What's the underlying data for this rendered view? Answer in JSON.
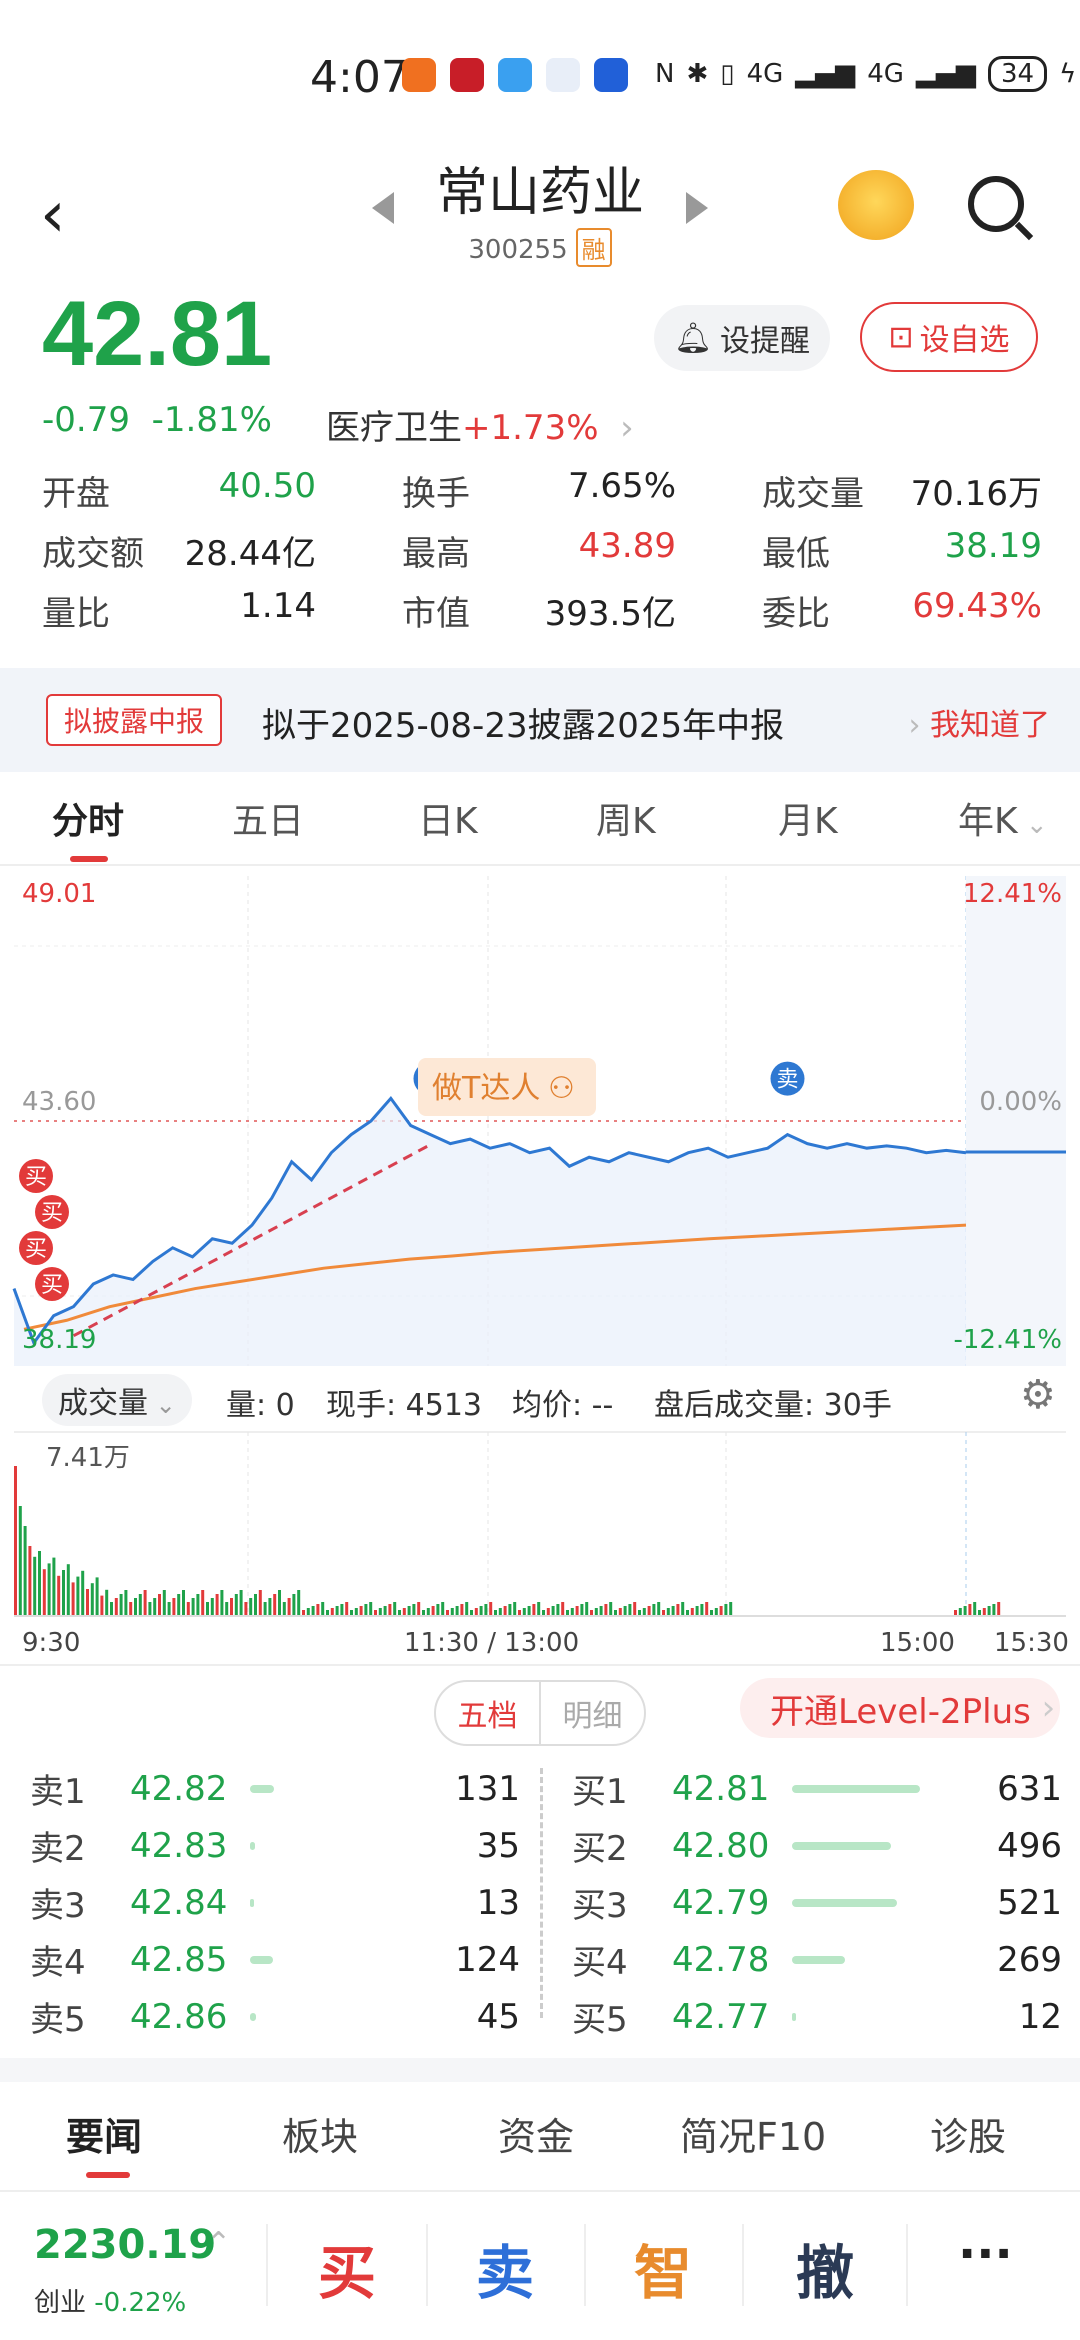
{
  "status_bar": {
    "time": "4:07",
    "net1": "4G",
    "net2": "4G",
    "battery": "34"
  },
  "header": {
    "title": "常山药业",
    "code": "300255",
    "margin_badge": "融"
  },
  "quote": {
    "price": "42.81",
    "change": "-0.79",
    "change_pct": "-1.81%",
    "sector_name": "医疗卫生",
    "sector_change": "+1.73%",
    "remind_label": "设提醒",
    "watch_label": "设自选"
  },
  "stats": [
    [
      {
        "label": "开盘",
        "value": "40.50",
        "color": "#1fa24a"
      },
      {
        "label": "换手",
        "value": "7.65%",
        "color": "#222222"
      },
      {
        "label": "成交量",
        "value": "70.16万",
        "color": "#222222"
      }
    ],
    [
      {
        "label": "成交额",
        "value": "28.44亿",
        "color": "#222222"
      },
      {
        "label": "最高",
        "value": "43.89",
        "color": "#e23a3a"
      },
      {
        "label": "最低",
        "value": "38.19",
        "color": "#1fa24a"
      }
    ],
    [
      {
        "label": "量比",
        "value": "1.14",
        "color": "#222222"
      },
      {
        "label": "市值",
        "value": "393.5亿",
        "color": "#222222"
      },
      {
        "label": "委比",
        "value": "69.43%",
        "color": "#e23a3a"
      }
    ]
  ],
  "notice": {
    "tag": "拟披露中报",
    "text": "拟于2025-08-23披露2025年中报",
    "ack": "我知道了"
  },
  "chart_tabs": [
    "分时",
    "五日",
    "日K",
    "周K",
    "月K",
    "年K"
  ],
  "chart_data": {
    "type": "line",
    "y_top": "49.01",
    "y_mid": "43.60",
    "y_bottom": "38.19",
    "pct_top": "12.41%",
    "pct_mid": "0.00%",
    "pct_bottom": "-12.41%",
    "ylim": [
      38.19,
      49.01
    ],
    "prev_close": 43.6,
    "x_labels": [
      "9:30",
      "11:30 / 13:00",
      "15:00",
      "15:30"
    ],
    "series": [],
    "price_points": [
      39.9,
      38.7,
      39.3,
      39.5,
      40.0,
      40.2,
      40.1,
      40.5,
      40.8,
      40.6,
      41.0,
      40.9,
      41.3,
      41.9,
      42.7,
      42.3,
      42.9,
      43.3,
      43.6,
      44.1,
      43.5,
      43.3,
      43.1,
      43.2,
      43.0,
      43.1,
      42.9,
      43.0,
      42.6,
      42.8,
      42.7,
      42.9,
      42.8,
      42.7,
      42.9,
      43.0,
      42.8,
      42.9,
      43.0,
      43.3,
      43.1,
      43.0,
      43.1,
      43.0,
      43.05,
      43.0,
      42.9,
      42.95,
      42.9
    ],
    "avg_points": [
      39.0,
      39.2,
      39.5,
      39.7,
      39.9,
      40.05,
      40.2,
      40.35,
      40.45,
      40.55,
      40.62,
      40.7,
      40.76,
      40.82,
      40.88,
      40.94,
      41.0,
      41.05,
      41.1,
      41.15,
      41.2,
      41.25,
      41.3
    ],
    "markers": [
      {
        "type": "买",
        "index": 2
      },
      {
        "type": "买",
        "index": 3
      },
      {
        "type": "买",
        "index": 4
      },
      {
        "type": "买",
        "index": 5
      },
      {
        "type": "卖",
        "index": 21
      },
      {
        "type": "卖",
        "index": 39
      }
    ],
    "annotation": "做T达人",
    "volume_max_label": "7.41万"
  },
  "volume_bar": {
    "label": "成交量",
    "info": "量: 0",
    "hand": "现手: 4513",
    "avg": "均价: --",
    "after": "盘后成交量: 30手"
  },
  "orderbook": {
    "seg_on": "五档",
    "seg_off": "明细",
    "level2": "开通Level-2Plus",
    "asks": [
      {
        "label": "卖1",
        "price": "42.82",
        "qty": "131",
        "bar": 0.16
      },
      {
        "label": "卖2",
        "price": "42.83",
        "qty": "35",
        "bar": 0.03
      },
      {
        "label": "卖3",
        "price": "42.84",
        "qty": "13",
        "bar": 0.01
      },
      {
        "label": "卖4",
        "price": "42.85",
        "qty": "124",
        "bar": 0.15
      },
      {
        "label": "卖5",
        "price": "42.86",
        "qty": "45",
        "bar": 0.04
      }
    ],
    "bids": [
      {
        "label": "买1",
        "price": "42.81",
        "qty": "631",
        "bar": 0.85
      },
      {
        "label": "买2",
        "price": "42.80",
        "qty": "496",
        "bar": 0.66
      },
      {
        "label": "买3",
        "price": "42.79",
        "qty": "521",
        "bar": 0.7
      },
      {
        "label": "买4",
        "price": "42.78",
        "qty": "269",
        "bar": 0.35
      },
      {
        "label": "买5",
        "price": "42.77",
        "qty": "12",
        "bar": 0.01
      }
    ]
  },
  "news_tabs": [
    "要闻",
    "板块",
    "资金",
    "简况F10",
    "诊股"
  ],
  "bottom": {
    "index_value": "2230.19",
    "index_name": "创业",
    "index_change": "-0.22%",
    "buy": "买",
    "sell": "卖",
    "smart": "智",
    "cancel": "撤",
    "more": "···"
  },
  "colors": {
    "up": "#e23a3a",
    "down": "#1fa24a",
    "line": "#2e78d2",
    "avg": "#f08a3a"
  }
}
